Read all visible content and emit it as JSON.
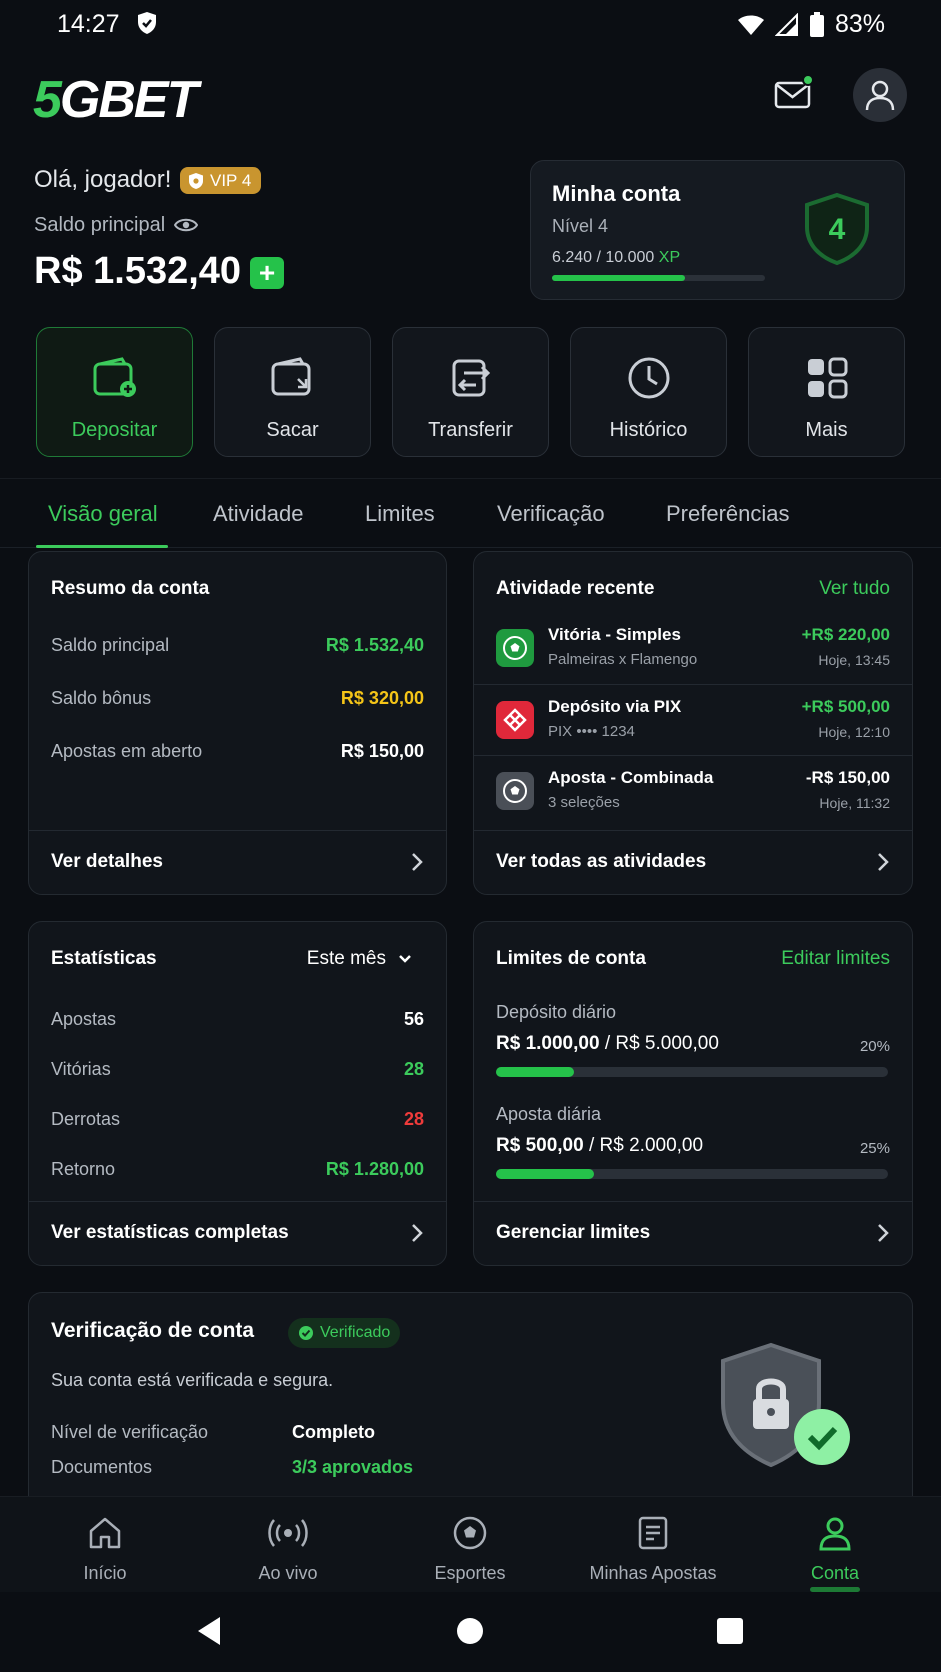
{
  "status_bar": {
    "time": "14:27",
    "battery": "83%"
  },
  "header": {
    "logo_prefix": "5",
    "logo_rest": "GBET"
  },
  "user": {
    "greeting": "Olá, jogador!",
    "vip": "VIP 4",
    "balance_label": "Saldo principal",
    "balance": "R$ 1.532,40",
    "add_label": "+"
  },
  "account_card": {
    "title": "Minha conta",
    "level": "Nível 4",
    "xp_text": "6.240 / 10.000",
    "xp_unit": "XP",
    "xp_progress": 0.624,
    "level_number": "4"
  },
  "actions": [
    {
      "label": "Depositar",
      "icon": "wallet-plus-icon"
    },
    {
      "label": "Sacar",
      "icon": "wallet-withdraw-icon"
    },
    {
      "label": "Transferir",
      "icon": "transfer-icon"
    },
    {
      "label": "Histórico",
      "icon": "clock-icon"
    },
    {
      "label": "Mais",
      "icon": "grid-icon"
    }
  ],
  "tabs": [
    "Visão geral",
    "Atividade",
    "Limites",
    "Verificação",
    "Preferências"
  ],
  "summary": {
    "title": "Resumo da conta",
    "rows": [
      {
        "label": "Saldo principal",
        "value": "R$ 1.532,40"
      },
      {
        "label": "Saldo bônus",
        "value": "R$ 320,00"
      },
      {
        "label": "Apostas em aberto",
        "value": "R$ 150,00"
      }
    ],
    "footer": "Ver detalhes"
  },
  "activity": {
    "title": "Atividade recente",
    "link": "Ver tudo",
    "items": [
      {
        "title": "Vitória - Simples",
        "sub": "Palmeiras x Flamengo",
        "amount": "+R$ 220,00",
        "time": "Hoje, 13:45",
        "icon": "soccer-ball-icon"
      },
      {
        "title": "Depósito via PIX",
        "sub": "PIX •••• 1234",
        "amount": "+R$ 500,00",
        "time": "Hoje, 12:10",
        "icon": "pix-icon"
      },
      {
        "title": "Aposta - Combinada",
        "sub": "3 seleções",
        "amount": "-R$ 150,00",
        "time": "Hoje, 11:32",
        "icon": "soccer-ball-icon"
      }
    ],
    "footer": "Ver todas as atividades"
  },
  "stats": {
    "title": "Estatísticas",
    "period": "Este mês",
    "rows": [
      {
        "label": "Apostas",
        "value": "56"
      },
      {
        "label": "Vitórias",
        "value": "28"
      },
      {
        "label": "Derrotas",
        "value": "28"
      },
      {
        "label": "Retorno",
        "value": "R$ 1.280,00"
      }
    ],
    "footer": "Ver estatísticas completas"
  },
  "limits": {
    "title": "Limites de conta",
    "link": "Editar limites",
    "items": [
      {
        "label": "Depósito diário",
        "used": "R$ 1.000,00",
        "total": "/ R$ 5.000,00",
        "pct": "20%",
        "fraction": 0.2
      },
      {
        "label": "Aposta diária",
        "used": "R$ 500,00",
        "total": "/ R$ 2.000,00",
        "pct": "25%",
        "fraction": 0.25
      }
    ],
    "footer": "Gerenciar limites"
  },
  "verification": {
    "title": "Verificação de conta",
    "badge": "Verificado",
    "text": "Sua conta está verificada e segura.",
    "level_label": "Nível de verificação",
    "level_value": "Completo",
    "docs_label": "Documentos",
    "docs_value": "3/3 aprovados"
  },
  "bottom_nav": [
    {
      "label": "Início",
      "icon": "home-icon"
    },
    {
      "label": "Ao vivo",
      "icon": "live-icon"
    },
    {
      "label": "Esportes",
      "icon": "soccer-ball-icon"
    },
    {
      "label": "Minhas Apostas",
      "icon": "bets-icon"
    },
    {
      "label": "Conta",
      "icon": "user-icon"
    }
  ],
  "colors": {
    "accent": "#3ccb5c",
    "bonus": "#f5c518",
    "loss": "#ef3b3b",
    "vip": "#c9952f"
  }
}
